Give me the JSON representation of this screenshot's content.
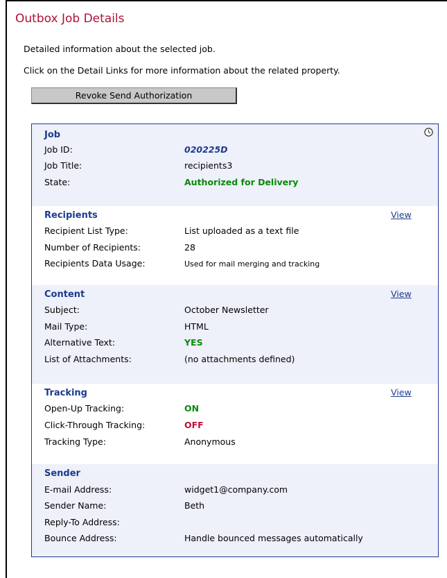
{
  "page": {
    "title": "Outbox Job Details",
    "intro_line1": "Detailed information about the selected job.",
    "intro_line2": "Click on the Detail Links for more information about the related property.",
    "revoke_button": "Revoke Send Authorization"
  },
  "job": {
    "heading": "Job",
    "rows": [
      {
        "label": "Job ID:",
        "value": "020225D"
      },
      {
        "label": "Job Title:",
        "value": "recipients3"
      },
      {
        "label": "State:",
        "value": "Authorized for Delivery"
      }
    ],
    "icon": "clock-icon"
  },
  "recipients": {
    "heading": "Recipients",
    "view": "View",
    "rows": [
      {
        "label": "Recipient List Type:",
        "value": "List uploaded as a text file"
      },
      {
        "label": "Number of Recipients:",
        "value": "28"
      },
      {
        "label": "Recipients Data Usage:",
        "value": "Used for mail merging and tracking"
      }
    ]
  },
  "content": {
    "heading": "Content",
    "view": "View",
    "rows": [
      {
        "label": "Subject:",
        "value": "October Newsletter"
      },
      {
        "label": "Mail Type:",
        "value": "HTML"
      },
      {
        "label": "Alternative Text:",
        "value": "YES"
      },
      {
        "label": "List of Attachments:",
        "value": "(no attachments defined)"
      }
    ]
  },
  "tracking": {
    "heading": "Tracking",
    "view": "View",
    "rows": [
      {
        "label": "Open-Up Tracking:",
        "value": "ON"
      },
      {
        "label": "Click-Through Tracking:",
        "value": "OFF"
      },
      {
        "label": "Tracking Type:",
        "value": "Anonymous"
      }
    ]
  },
  "sender": {
    "heading": "Sender",
    "rows": [
      {
        "label": "E-mail Address:",
        "value": "widget1@company.com"
      },
      {
        "label": "Sender Name:",
        "value": "Beth"
      },
      {
        "label": "Reply-To Address:",
        "value": ""
      },
      {
        "label": "Bounce Address:",
        "value": "Handle bounced messages automatically"
      }
    ]
  },
  "colors": {
    "title": "#b0103a",
    "heading": "#1c3b8e",
    "shade": "#eef0fa",
    "positive": "#0a8a0a",
    "negative": "#c0103a"
  }
}
